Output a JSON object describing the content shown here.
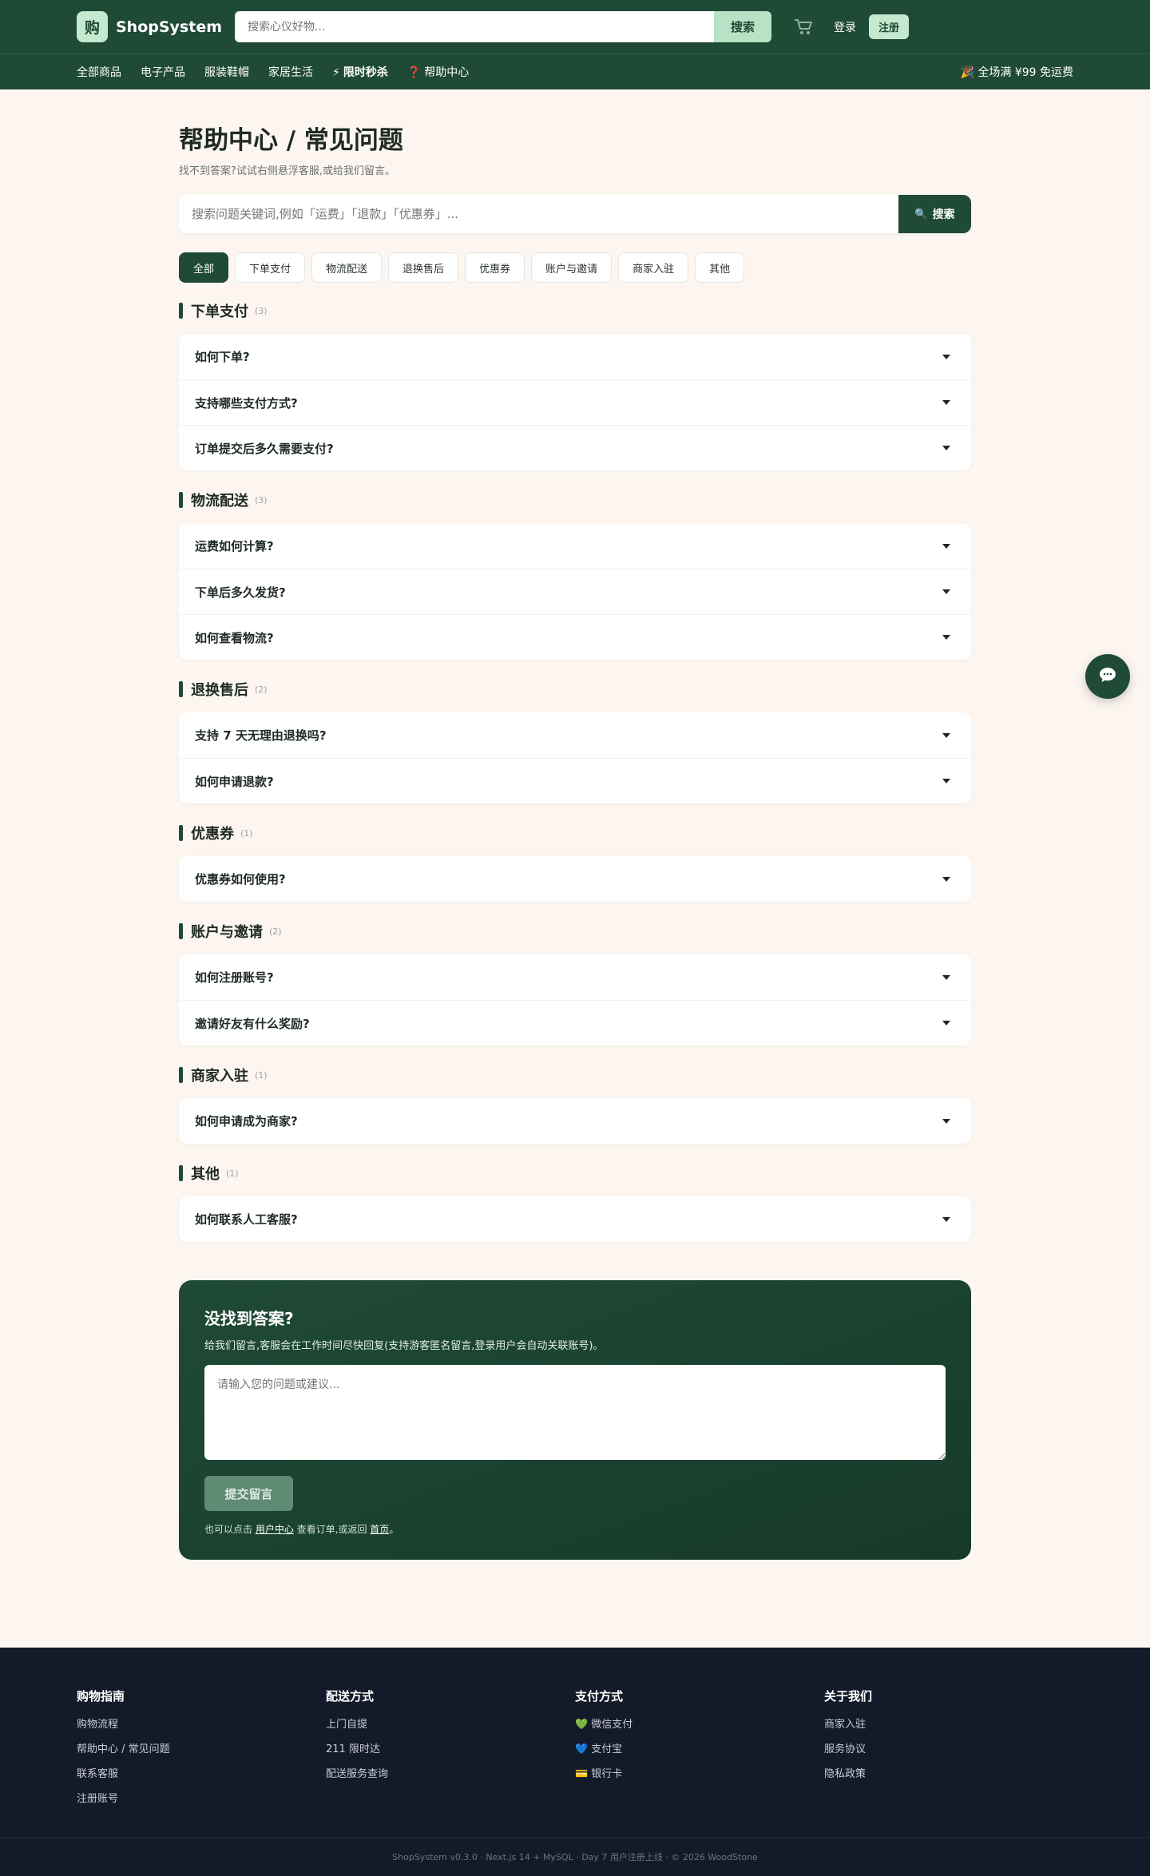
{
  "header": {
    "logo_char": "购",
    "brand": "ShopSystem",
    "search_placeholder": "搜索心仪好物...",
    "search_button": "搜索",
    "cart_icon": "cart-icon",
    "login": "登录",
    "register": "注册"
  },
  "nav": {
    "items": [
      {
        "label": "全部商品"
      },
      {
        "label": "电子产品"
      },
      {
        "label": "服装鞋帽"
      },
      {
        "label": "家居生活"
      },
      {
        "icon": "⚡",
        "label": "限时秒杀"
      },
      {
        "icon": "❓",
        "label": "帮助中心"
      }
    ],
    "promo_icon": "🎉",
    "promo": "全场满 ¥99 免运费"
  },
  "page": {
    "title": "帮助中心 / 常见问题",
    "subtitle": "找不到答案?试试右侧悬浮客服,或给我们留言。",
    "search_placeholder": "搜索问题关键词,例如「运费」「退款」「优惠券」...",
    "search_button": "搜索"
  },
  "chips": [
    "全部",
    "下单支付",
    "物流配送",
    "退换售后",
    "优惠券",
    "账户与邀请",
    "商家入驻",
    "其他"
  ],
  "sections": [
    {
      "title": "下单支付",
      "count": "(3)",
      "questions": [
        "如何下单?",
        "支持哪些支付方式?",
        "订单提交后多久需要支付?"
      ]
    },
    {
      "title": "物流配送",
      "count": "(3)",
      "questions": [
        "运费如何计算?",
        "下单后多久发货?",
        "如何查看物流?"
      ]
    },
    {
      "title": "退换售后",
      "count": "(2)",
      "questions": [
        "支持 7 天无理由退换吗?",
        "如何申请退款?"
      ]
    },
    {
      "title": "优惠券",
      "count": "(1)",
      "questions": [
        "优惠券如何使用?"
      ]
    },
    {
      "title": "账户与邀请",
      "count": "(2)",
      "questions": [
        "如何注册账号?",
        "邀请好友有什么奖励?"
      ]
    },
    {
      "title": "商家入驻",
      "count": "(1)",
      "questions": [
        "如何申请成为商家?"
      ]
    },
    {
      "title": "其他",
      "count": "(1)",
      "questions": [
        "如何联系人工客服?"
      ]
    }
  ],
  "contact": {
    "title": "没找到答案?",
    "subtitle": "给我们留言,客服会在工作时间尽快回复(支持游客匿名留言,登录用户会自动关联账号)。",
    "placeholder": "请输入您的问题或建议...",
    "submit": "提交留言",
    "note_prefix": "也可以点击 ",
    "note_link1": "用户中心",
    "note_mid": " 查看订单,或返回 ",
    "note_link2": "首页",
    "note_suffix": "。"
  },
  "footer": {
    "columns": [
      {
        "title": "购物指南",
        "items": [
          {
            "label": "购物流程"
          },
          {
            "label": "帮助中心 / 常见问题"
          },
          {
            "label": "联系客服"
          },
          {
            "label": "注册账号"
          }
        ]
      },
      {
        "title": "配送方式",
        "items": [
          {
            "label": "上门自提"
          },
          {
            "label": "211 限时达"
          },
          {
            "label": "配送服务查询"
          }
        ]
      },
      {
        "title": "支付方式",
        "items": [
          {
            "icon": "💚",
            "label": "微信支付"
          },
          {
            "icon": "💙",
            "label": "支付宝"
          },
          {
            "icon": "💳",
            "label": "银行卡"
          }
        ]
      },
      {
        "title": "关于我们",
        "items": [
          {
            "label": "商家入驻"
          },
          {
            "label": "服务协议"
          },
          {
            "label": "隐私政策"
          }
        ]
      }
    ],
    "copyright": "ShopSystem v0.3.0 · Next.js 14 + MySQL · Day 7 用户注册上线 · © 2026 WoodStone"
  },
  "colors": {
    "primary": "#1f4a36",
    "accent": "#c4e9cf",
    "background": "#fdf6f0",
    "footer": "#131a29"
  }
}
